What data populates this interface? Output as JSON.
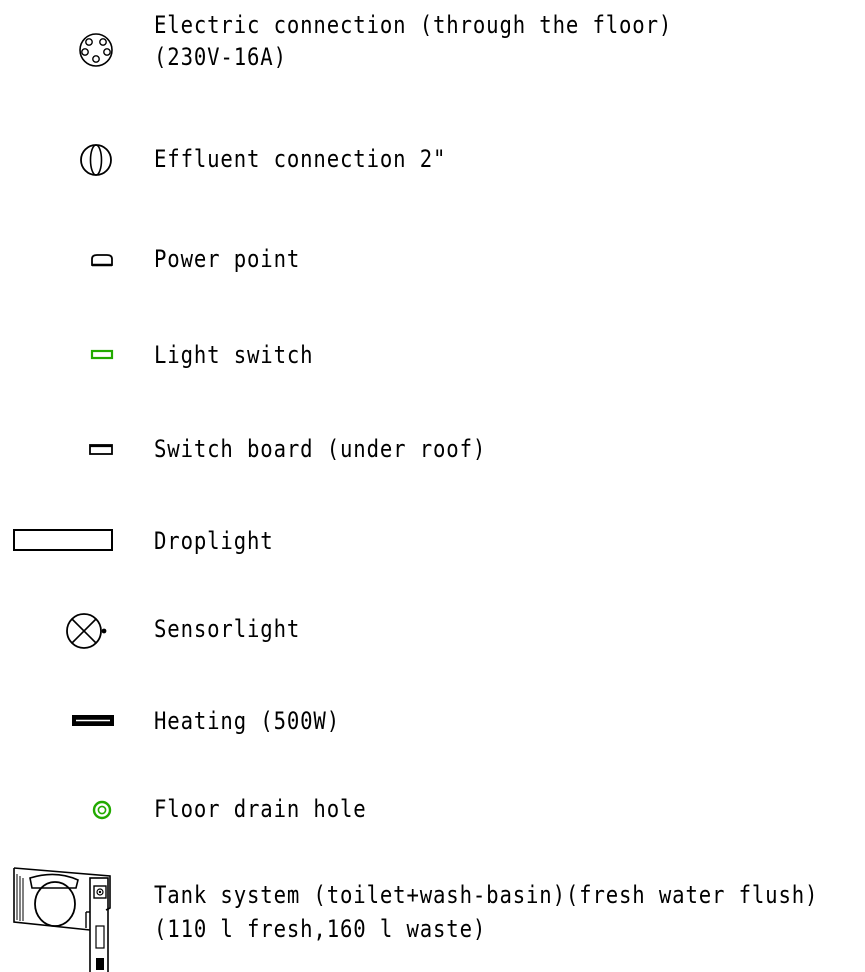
{
  "legend": {
    "items": [
      {
        "symbol": "electric-connection-icon",
        "lines": [
          "Electric connection (through the floor)",
          "(230V-16A)"
        ]
      },
      {
        "symbol": "effluent-connection-icon",
        "lines": [
          "Effluent connection 2\""
        ]
      },
      {
        "symbol": "power-point-icon",
        "lines": [
          "Power point"
        ]
      },
      {
        "symbol": "light-switch-icon",
        "color": "#22aa00",
        "lines": [
          "Light switch"
        ]
      },
      {
        "symbol": "switch-board-icon",
        "lines": [
          "Switch board (under roof)"
        ]
      },
      {
        "symbol": "droplight-icon",
        "lines": [
          "Droplight"
        ]
      },
      {
        "symbol": "sensorlight-icon",
        "lines": [
          "Sensorlight"
        ]
      },
      {
        "symbol": "heating-icon",
        "lines": [
          "Heating (500W)"
        ]
      },
      {
        "symbol": "floor-drain-hole-icon",
        "color": "#22aa00",
        "lines": [
          "Floor drain hole"
        ]
      },
      {
        "symbol": "tank-system-icon",
        "lines": [
          "Tank system (toilet+wash-basin)(fresh water flush)",
          "(110 l fresh,160 l waste)"
        ]
      }
    ]
  }
}
